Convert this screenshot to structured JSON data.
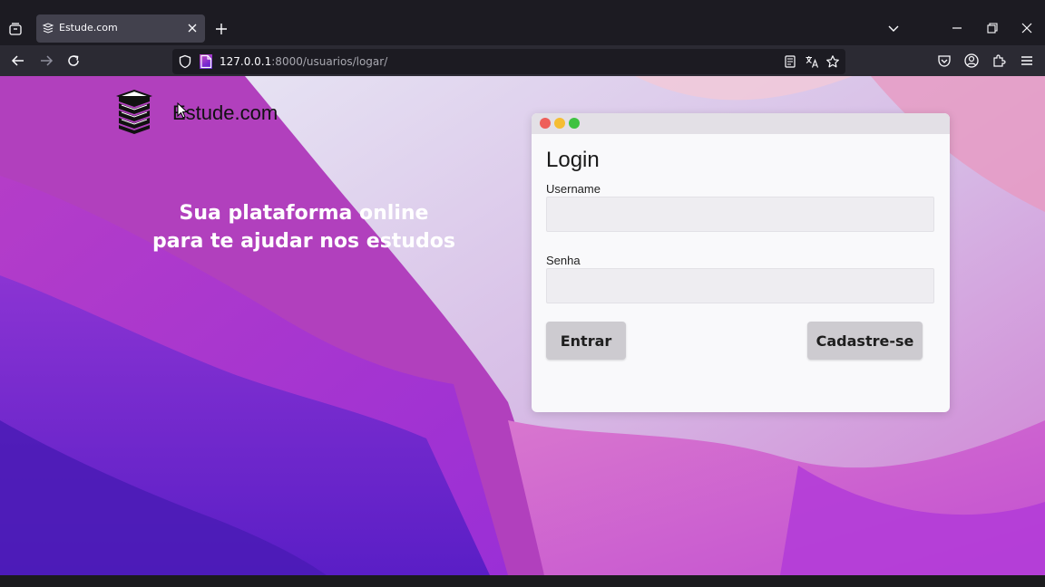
{
  "browser": {
    "tab_title": "Estude.com",
    "url_host": "127.0.0.1",
    "url_path": ":8000/usuarios/logar/",
    "icons": [
      "tab-list-icon",
      "tab-favicon-icon",
      "tab-close-icon",
      "new-tab-icon",
      "chevron-down-icon",
      "minimize-icon",
      "restore-icon",
      "close-icon",
      "back-icon",
      "forward-icon",
      "reload-icon",
      "shield-icon",
      "page-icon",
      "reader-view-icon",
      "translate-icon",
      "star-icon",
      "pocket-icon",
      "account-icon",
      "extensions-icon",
      "menu-icon"
    ]
  },
  "page": {
    "brand": "Estude.com",
    "tagline_line1": "Sua plataforma online",
    "tagline_line2": "para te ajudar nos estudos"
  },
  "login": {
    "title": "Login",
    "username_label": "Username",
    "username_value": "",
    "password_label": "Senha",
    "password_value": "",
    "submit_label": "Entrar",
    "signup_label": "Cadastre-se"
  },
  "colors": {
    "card_bg": "#f9f9fb",
    "button_bg": "#cdcbd0",
    "dot_red": "#ee5f5a",
    "dot_yellow": "#f5bd33",
    "dot_green": "#3ec241"
  }
}
